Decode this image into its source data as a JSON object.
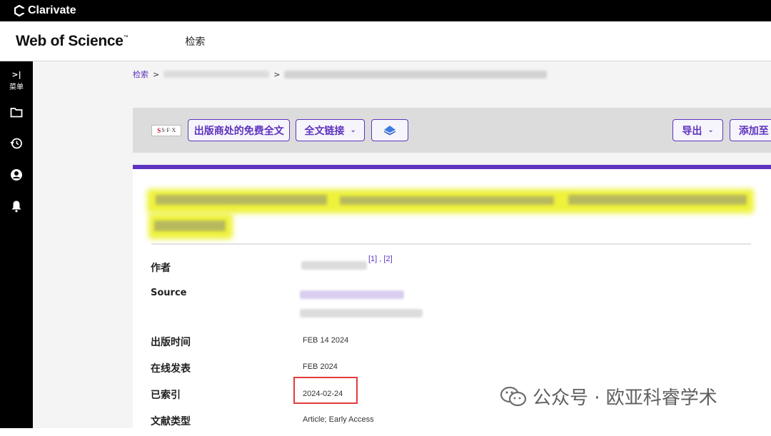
{
  "brand": {
    "name": "Clarivate"
  },
  "header": {
    "product": "Web of Science",
    "trademark": "™",
    "nav_search": "检索"
  },
  "sidebar": {
    "menu_label": "菜单",
    "menu_arrow": ">|"
  },
  "breadcrumb": {
    "first": "检索",
    "sep": ">"
  },
  "toolbar": {
    "sfx_label": "S·F·X",
    "free_fulltext": "出版商处的免费全文",
    "fulltext_links": "全文链接",
    "export": "导出",
    "add_to": "添加至"
  },
  "record": {
    "fields": [
      {
        "label": "作者",
        "refs": "[1] , [2]"
      },
      {
        "label": "Source"
      },
      {
        "label": "出版时间",
        "value": "FEB 14 2024"
      },
      {
        "label": "在线发表",
        "value": "FEB 2024"
      },
      {
        "label": "已索引",
        "value": "2024-02-24"
      },
      {
        "label": "文献类型",
        "value": "Article; Early Access"
      }
    ]
  },
  "watermark": {
    "text": "公众号 · 欧亚科睿学术"
  },
  "colors": {
    "accent": "#5e33bf",
    "highlight": "#eef23a",
    "redbox": "#e23b3b"
  }
}
